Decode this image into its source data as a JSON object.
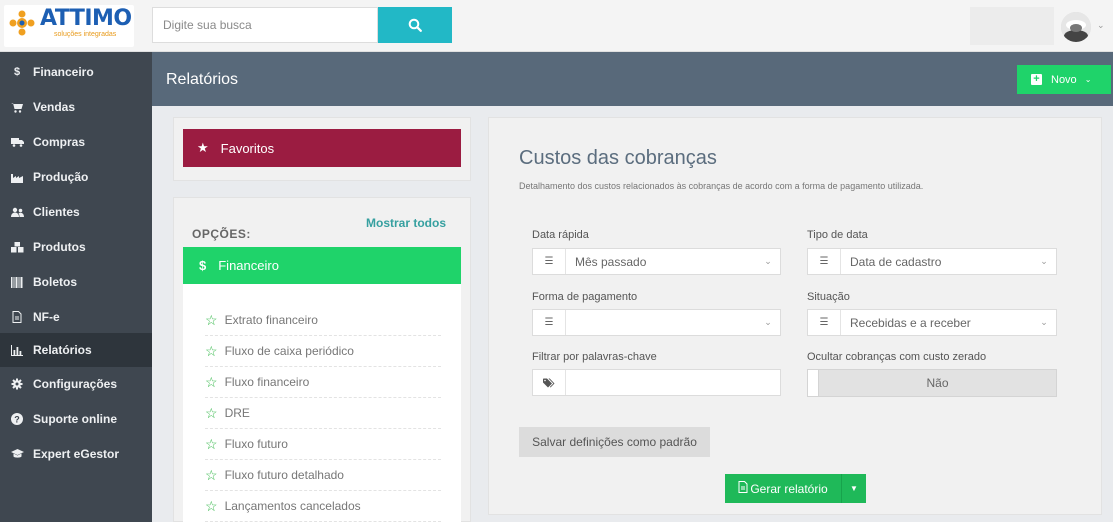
{
  "app": {
    "logo_text": "ATTIMO",
    "logo_subtitle": "soluções integradas",
    "logo_tagline": "",
    "search_placeholder": "Digite sua busca"
  },
  "sidebar": {
    "items": [
      {
        "label": "Financeiro",
        "icon": "dollar-icon"
      },
      {
        "label": "Vendas",
        "icon": "cart-icon"
      },
      {
        "label": "Compras",
        "icon": "truck-icon"
      },
      {
        "label": "Produção",
        "icon": "factory-icon"
      },
      {
        "label": "Clientes",
        "icon": "users-icon"
      },
      {
        "label": "Produtos",
        "icon": "cubes-icon"
      },
      {
        "label": "Boletos",
        "icon": "barcode-icon"
      },
      {
        "label": "NF-e",
        "icon": "file-icon"
      },
      {
        "label": "Relatórios",
        "icon": "bar-chart-icon",
        "active": true
      },
      {
        "label": "Configurações",
        "icon": "gear-icon"
      },
      {
        "label": "Suporte online",
        "icon": "question-icon"
      },
      {
        "label": "Expert eGestor",
        "icon": "graduation-cap-icon"
      }
    ]
  },
  "header": {
    "title": "Relatórios",
    "new_button": "Novo"
  },
  "favorites": {
    "label": "Favoritos"
  },
  "options": {
    "label": "OPÇÕES:",
    "show_all": "Mostrar todos",
    "category": "Financeiro",
    "reports": [
      "Extrato financeiro",
      "Fluxo de caixa periódico",
      "Fluxo financeiro",
      "DRE",
      "Fluxo futuro",
      "Fluxo futuro detalhado",
      "Lançamentos cancelados"
    ]
  },
  "report": {
    "title": "Custos das cobranças",
    "description": "Detalhamento dos custos relacionados às cobranças de acordo com a forma de pagamento utilizada.",
    "fields": {
      "quick_date": {
        "label": "Data rápida",
        "value": "Mês passado"
      },
      "date_type": {
        "label": "Tipo de data",
        "value": "Data de cadastro"
      },
      "payment_method": {
        "label": "Forma de pagamento",
        "value": ""
      },
      "status": {
        "label": "Situação",
        "value": "Recebidas e a receber"
      },
      "keywords": {
        "label": "Filtrar por palavras-chave",
        "value": ""
      },
      "hide_zero": {
        "label": "Ocultar cobranças com custo zerado",
        "value": "Não"
      }
    },
    "save_default": "Salvar definições como padrão",
    "generate": "Gerar relatório"
  },
  "colors": {
    "sidebar_bg": "#3f4750",
    "header_bg": "#58697a",
    "accent_green": "#1fd36a",
    "favorites_bg": "#9b1c41",
    "search_button": "#22b8c6"
  }
}
